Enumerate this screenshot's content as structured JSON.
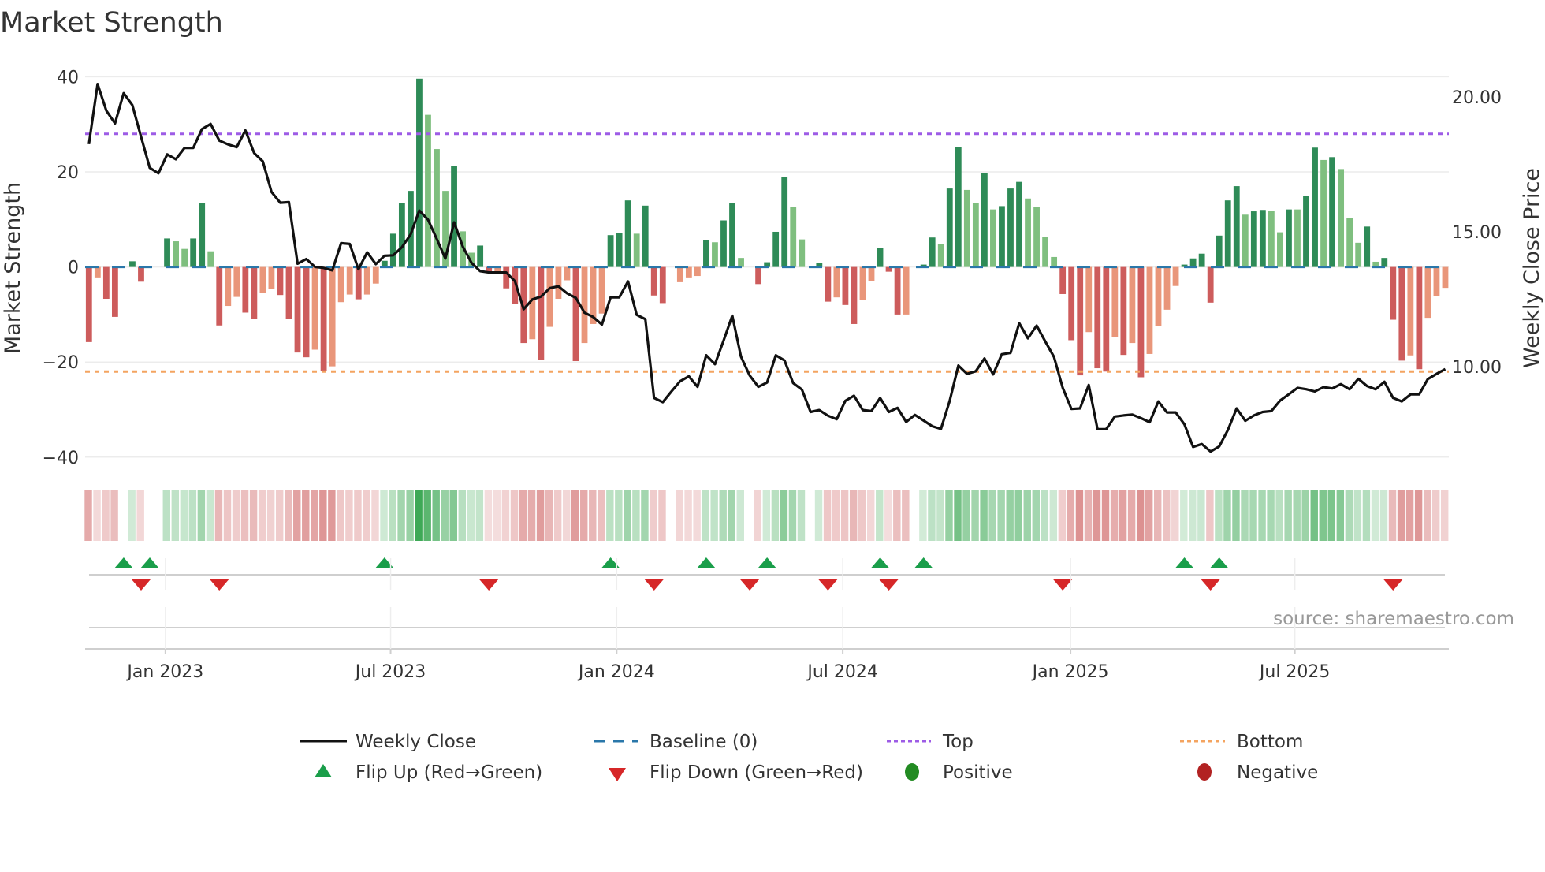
{
  "chart_data": {
    "type": "bar",
    "title": "Market Strength",
    "ylabel": "Market Strength",
    "ylabel_right": "Weekly Close Price",
    "ylim": [
      -42,
      42
    ],
    "yticks": [
      {
        "v": 40,
        "label": "40"
      },
      {
        "v": 20,
        "label": "20"
      },
      {
        "v": 0,
        "label": "0"
      },
      {
        "v": -20,
        "label": "−20"
      },
      {
        "v": -40,
        "label": "−40"
      }
    ],
    "ylim_right": [
      6,
      21
    ],
    "yticks_right": [
      {
        "v": 20,
        "label": "20.00"
      },
      {
        "v": 15,
        "label": "15.00"
      },
      {
        "v": 10,
        "label": "10.00"
      }
    ],
    "xticks": [
      {
        "week": 8.8,
        "label": "Jan 2023"
      },
      {
        "week": 34.7,
        "label": "Jul 2023"
      },
      {
        "week": 60.7,
        "label": "Jan 2024"
      },
      {
        "week": 86.7,
        "label": "Jul 2024"
      },
      {
        "week": 112.9,
        "label": "Jan 2025"
      },
      {
        "week": 138.7,
        "label": "Jul 2025"
      }
    ],
    "top_level": 28,
    "bottom_level": -22,
    "baseline": 0,
    "strength": [
      -15.8,
      -2.2,
      -6.7,
      -10.5,
      0,
      1.2,
      -3.1,
      0,
      0,
      6.0,
      5.4,
      3.8,
      6.0,
      13.5,
      3.3,
      -12.3,
      -8.2,
      -6.3,
      -9.6,
      -11,
      -5.5,
      -4.7,
      -5.9,
      -10.9,
      -18,
      -19,
      -17.4,
      -21.8,
      -20.9,
      -7.4,
      -5.8,
      -6.8,
      -5.8,
      -3.5,
      1.3,
      7,
      13.5,
      16,
      39.6,
      32,
      24.8,
      16,
      21.2,
      7.5,
      3,
      4.5,
      -1,
      -1,
      -4.5,
      -7.7,
      -16,
      -15.2,
      -19.6,
      -12.6,
      -6.7,
      -2.8,
      -19.8,
      -16,
      -12,
      -9.8,
      6.7,
      7.2,
      14,
      7,
      12.9,
      -6,
      -7.6,
      0,
      -3.2,
      -2.2,
      -1.9,
      5.6,
      5.2,
      9.8,
      13.4,
      1.9,
      0,
      -3.6,
      1,
      7.4,
      18.9,
      12.7,
      5.8,
      0,
      0.8,
      -7.3,
      -6.4,
      -8,
      -12,
      -7,
      -3,
      4,
      -1,
      -10,
      -10,
      0,
      0.5,
      6.2,
      4.8,
      16.5,
      25.2,
      16.2,
      13.4,
      19.7,
      12.1,
      12.8,
      16.5,
      17.9,
      14.4,
      12.7,
      6.4,
      2.1,
      -5.7,
      -15.4,
      -22.8,
      -13.7,
      -21.3,
      -22,
      -14.8,
      -18.5,
      -16,
      -23.2,
      -18.3,
      -12.4,
      -9,
      -4,
      0.5,
      1.8,
      2.8,
      -7.5,
      6.6,
      14,
      17,
      11,
      11.7,
      12,
      11.8,
      7.3,
      12.1,
      12.1,
      15,
      25.1,
      22.5,
      23.1,
      20.6,
      10.3,
      5.1,
      8.5,
      1.1,
      1.9,
      -11.1,
      -19.7,
      -18.6,
      -21.5,
      -10.7,
      -6.1,
      -4.4
    ],
    "bar_shades": "RORRZGRZZGLLGGLROORROORRRRORO OOROOGGGGGLLLGLLGRORRROROOOROOOGGGLGRRZOOOGLGGLZRGGGLLZGRORROOGRROZGGLGGLLGLGGGLLLLRRRORRORORO OOOGGGRGGGLGGLLGLGGLGLLLGLGRRORO OO",
    "weekly_close": [
      18.25,
      20.48,
      19.49,
      19.02,
      20.14,
      19.7,
      18.52,
      17.37,
      17.17,
      17.87,
      17.69,
      18.11,
      18.11,
      18.81,
      19.0,
      18.38,
      18.24,
      18.14,
      18.76,
      17.92,
      17.61,
      16.48,
      16.08,
      16.1,
      13.82,
      13.99,
      13.7,
      13.66,
      13.57,
      14.58,
      14.55,
      13.61,
      14.24,
      13.8,
      14.11,
      14.13,
      14.43,
      14.9,
      15.79,
      15.45,
      14.74,
      14.01,
      15.35,
      14.45,
      13.85,
      13.54,
      13.49,
      13.49,
      13.49,
      13.17,
      12.13,
      12.49,
      12.6,
      12.91,
      12.98,
      12.72,
      12.55,
      12.0,
      11.84,
      11.56,
      12.57,
      12.57,
      13.16,
      11.92,
      11.76,
      8.84,
      8.68,
      9.08,
      9.46,
      9.64,
      9.25,
      10.42,
      10.09,
      10.97,
      11.89,
      10.37,
      9.67,
      9.25,
      9.41,
      10.42,
      10.23,
      9.39,
      9.15,
      8.32,
      8.39,
      8.18,
      8.05,
      8.73,
      8.92,
      8.39,
      8.35,
      8.84,
      8.32,
      8.47,
      7.95,
      8.21,
      8.0,
      7.79,
      7.69,
      8.73,
      10.04,
      9.73,
      9.83,
      10.3,
      9.71,
      10.46,
      10.51,
      11.61,
      11.05,
      11.52,
      10.93,
      10.36,
      9.21,
      8.43,
      8.45,
      9.32,
      7.68,
      7.68,
      8.15,
      8.19,
      8.22,
      8.09,
      7.94,
      8.71,
      8.3,
      8.3,
      7.86,
      7.02,
      7.13,
      6.85,
      7.04,
      7.65,
      8.45,
      7.99,
      8.19,
      8.32,
      8.35,
      8.74,
      8.97,
      9.21,
      9.16,
      9.08,
      9.24,
      9.19,
      9.35,
      9.16,
      9.55,
      9.28,
      9.16,
      9.44,
      8.84,
      8.71,
      8.97,
      8.97,
      9.54,
      9.73,
      9.91
    ],
    "flip_up_weeks": [
      4,
      7,
      34,
      60,
      71,
      78,
      91,
      96,
      126,
      130
    ],
    "flip_down_weeks": [
      6,
      15,
      46,
      65,
      76,
      85,
      92,
      112,
      129,
      150
    ],
    "legend": {
      "weekly_close": "Weekly Close",
      "baseline": "Baseline (0)",
      "top": "Top",
      "bottom": "Bottom",
      "flip_up": "Flip Up (Red→Green)",
      "flip_down": "Flip Down (Green→Red)",
      "positive": "Positive",
      "negative": "Negative"
    },
    "legend_placement": "bottom",
    "source": "source: sharemaestro.com"
  },
  "colors": {
    "strong_green": "#2e8b57",
    "weak_green": "#7fbf7f",
    "strong_red": "#cd5c5c",
    "weak_red": "#e9967a",
    "top": "#9d5ce6",
    "bottom": "#f4a460",
    "baseline": "#2a77aa",
    "flip_up": "#1a9e4a",
    "flip_down": "#d62728",
    "positive": "#228b22",
    "negative": "#b22222",
    "line": "#111111"
  }
}
